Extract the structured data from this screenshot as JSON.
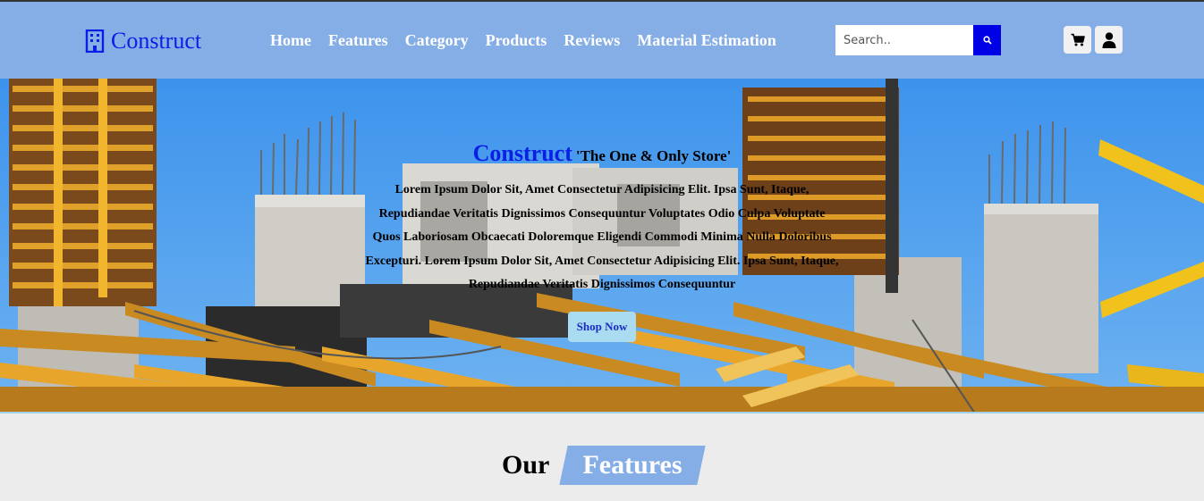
{
  "header": {
    "brand": "Construct",
    "nav": [
      "Home",
      "Features",
      "Category",
      "Products",
      "Reviews",
      "Material Estimation"
    ],
    "search": {
      "placeholder": "Search..",
      "icon": "search-icon"
    },
    "icons": [
      "cart-icon",
      "user-icon"
    ]
  },
  "hero": {
    "brand": "Construct",
    "tagline": "'The One & Only Store'",
    "text": "Lorem Ipsum Dolor Sit, Amet Consectetur Adipisicing Elit. Ipsa Sunt, Itaque, Repudiandae Veritatis Dignissimos Consequuntur Voluptates Odio Culpa Voluptate Quos Laboriosam Obcaecati Doloremque Eligendi Commodi Minima Nulla Doloribus Excepturi. Lorem Ipsum Dolor Sit, Amet Consectetur Adipisicing Elit. Ipsa Sunt, Itaque, Repudiandae Veritatis Dignissimos Consequuntur",
    "button": "Shop Now"
  },
  "features": {
    "our": "Our",
    "title": "Features"
  },
  "colors": {
    "header_bg": "#86aee6",
    "brand_blue": "#0a1fe6",
    "search_button": "#0000e6",
    "page_bg": "#ececec",
    "button_bg": "#a9dcf0"
  }
}
